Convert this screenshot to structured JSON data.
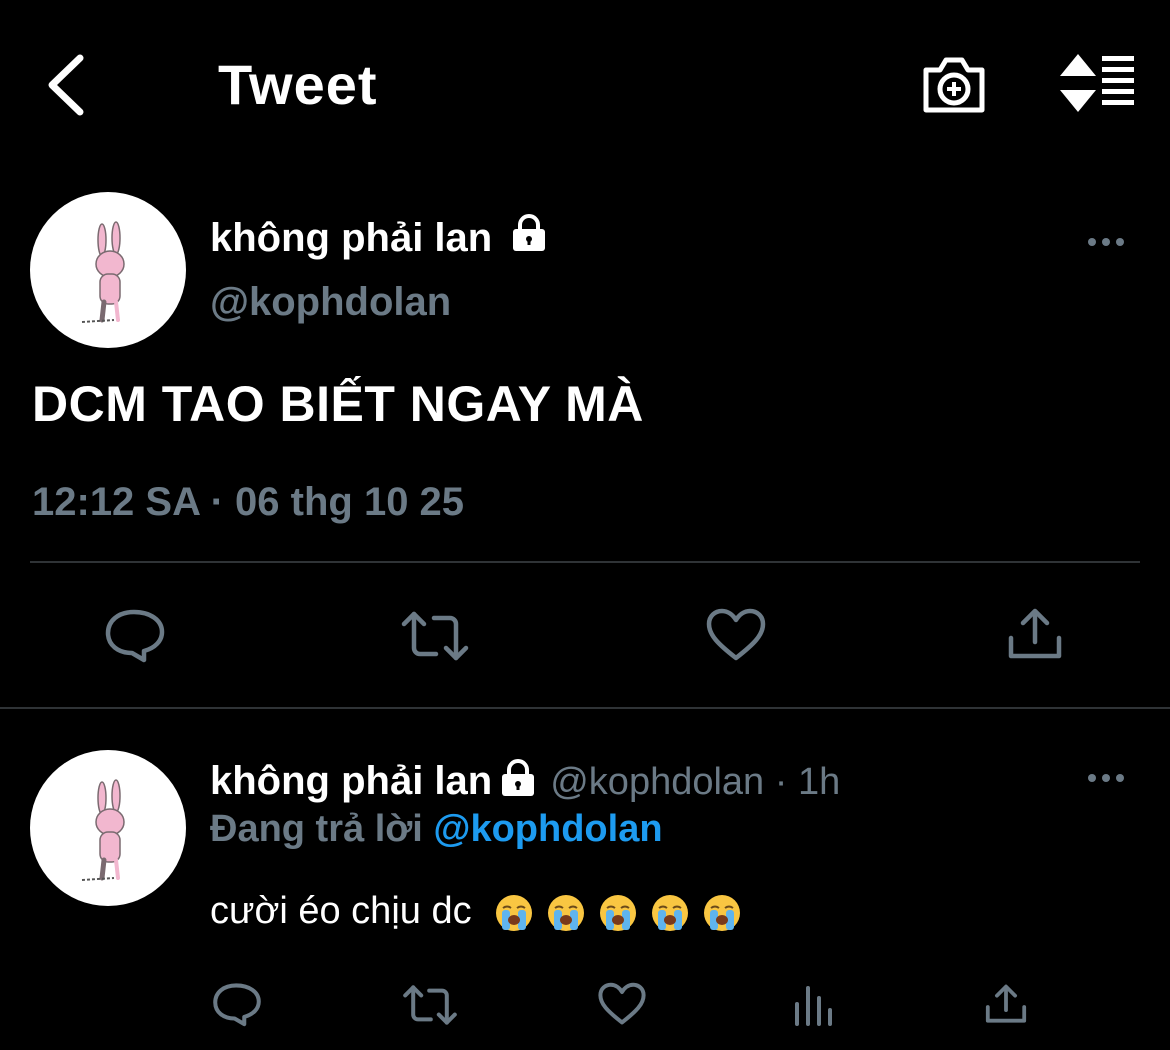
{
  "header": {
    "title": "Tweet",
    "back_icon": "chevron-left-icon",
    "camera_icon": "camera-plus-icon",
    "sort_icon": "sort-list-icon"
  },
  "main_tweet": {
    "display_name": "không phải lan",
    "handle": "@kophdolan",
    "text": "DCM TAO BIẾT NGAY MÀ",
    "timestamp": "12:12 SA · 06 thg 10 25"
  },
  "reply": {
    "display_name": "không phải lan",
    "meta": "@kophdolan · 1h",
    "replying_prefix": "Đang trả lời ",
    "replying_handle": "@kophdolan",
    "text": "cười éo chịu dc",
    "emojis": [
      "loudly-crying-face",
      "loudly-crying-face",
      "loudly-crying-face",
      "loudly-crying-face",
      "loudly-crying-face"
    ]
  },
  "colors": {
    "background": "#000000",
    "muted": "#6b7a86",
    "accent": "#1d9bf0",
    "divider": "#2f3336"
  }
}
